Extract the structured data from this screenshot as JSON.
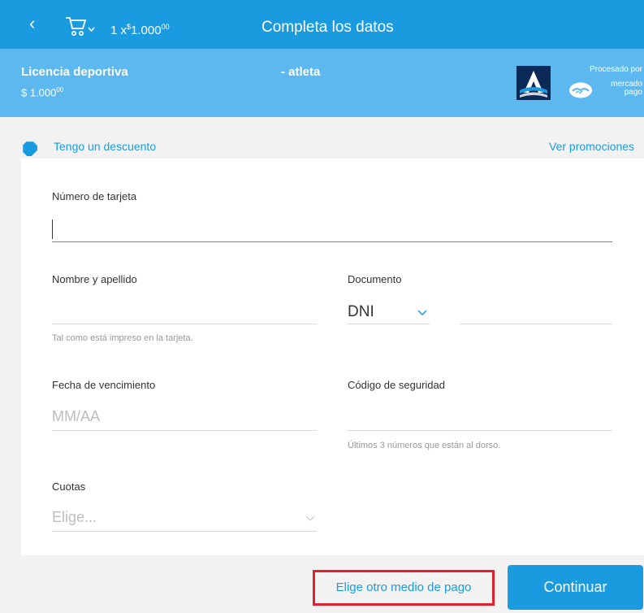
{
  "header": {
    "back_glyph": "‹",
    "quantity_prefix": "1 x",
    "currency": "$",
    "total_main": "1.000",
    "total_cents": "00",
    "title": "Completa los datos"
  },
  "product": {
    "name": "Licencia deportiva",
    "price_main": "$ 1.000",
    "price_cents": "00",
    "subtitle": "- atleta",
    "processed_by": "Procesado por",
    "processor_line1": "mercado",
    "processor_line2": "pago"
  },
  "discount": {
    "link": "Tengo un descuento",
    "promotions_link": "Ver promociones"
  },
  "form": {
    "card_number_label": "Número de tarjeta",
    "card_number_value": "",
    "name_label": "Nombre y apellido",
    "name_value": "",
    "name_hint": "Tal como está impreso en la tarjeta.",
    "document_label": "Documento",
    "document_type": "DNI",
    "document_value": "",
    "expiry_label": "Fecha de vencimiento",
    "expiry_placeholder": "MM/AA",
    "security_label": "Código de seguridad",
    "security_value": "",
    "security_hint": "Últimos 3 números que están al dorso.",
    "installments_label": "Cuotas",
    "installments_placeholder": "Elige..."
  },
  "actions": {
    "other_method": "Elige otro medio de pago",
    "continue": "Continuar"
  },
  "colors": {
    "primary": "#1a9be0",
    "band": "#5cb8ee",
    "highlight_border": "#e0212e"
  }
}
